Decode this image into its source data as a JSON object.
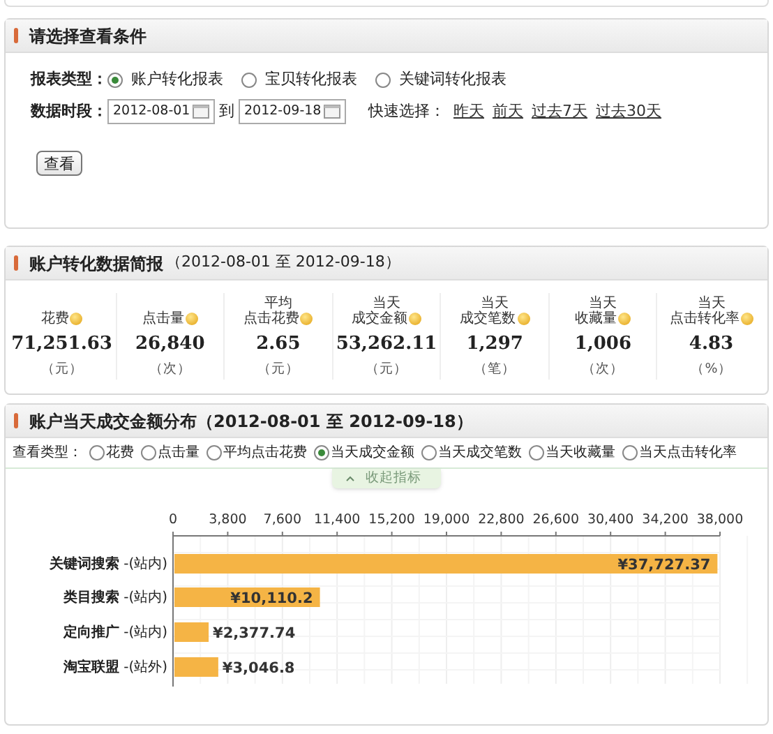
{
  "conditions_panel": {
    "title": "请选择查看条件",
    "report_type": {
      "label": "报表类型：",
      "options": [
        {
          "label": "账户转化报表",
          "selected": true
        },
        {
          "label": "宝贝转化报表",
          "selected": false
        },
        {
          "label": "关键词转化报表",
          "selected": false
        }
      ]
    },
    "date_range": {
      "label": "数据时段：",
      "start": "2012-08-01",
      "separator": "到",
      "end": "2012-09-18"
    },
    "quick_select": {
      "label": "快速选择：",
      "links": [
        "昨天",
        "前天",
        "过去7天",
        "过去30天"
      ]
    },
    "submit_button": "查看"
  },
  "summary_panel": {
    "title": "账户转化数据简报",
    "date_range": "（2012-08-01 至  2012-09-18）",
    "metrics": [
      {
        "label_lines": [
          "花费"
        ],
        "value": "71,251.63",
        "unit": "（元）"
      },
      {
        "label_lines": [
          "点击量"
        ],
        "value": "26,840",
        "unit": "（次）"
      },
      {
        "label_lines": [
          "平均",
          "点击花费"
        ],
        "value": "2.65",
        "unit": "（元）"
      },
      {
        "label_lines": [
          "当天",
          "成交金额"
        ],
        "value": "53,262.11",
        "unit": "（元）"
      },
      {
        "label_lines": [
          "当天",
          "成交笔数"
        ],
        "value": "1,297",
        "unit": "（笔）"
      },
      {
        "label_lines": [
          "当天",
          "收藏量"
        ],
        "value": "1,006",
        "unit": "（次）"
      },
      {
        "label_lines": [
          "当天",
          "点击转化率"
        ],
        "value": "4.83",
        "unit": "（%）"
      }
    ]
  },
  "distribution_panel": {
    "title": "账户当天成交金额分布（2012-08-01 至  2012-09-18）",
    "view_type": {
      "label": "查看类型：",
      "options": [
        {
          "label": "花费",
          "selected": false
        },
        {
          "label": "点击量",
          "selected": false
        },
        {
          "label": "平均点击花费",
          "selected": false
        },
        {
          "label": "当天成交金额",
          "selected": true
        },
        {
          "label": "当天成交笔数",
          "selected": false
        },
        {
          "label": "当天收藏量",
          "selected": false
        },
        {
          "label": "当天点击转化率",
          "selected": false
        }
      ]
    },
    "collapse_toggle": "收起指标",
    "chart_data": {
      "type": "bar",
      "orientation": "horizontal",
      "categories": [
        "**关键词搜索** -(站内)",
        "**类目搜索** -(站内)",
        "**定向推广** -(站内)",
        "**淘宝联盟** -(站外)"
      ],
      "series": [
        {
          "color": "#f5b445",
          "values": [
            37727.37,
            10110.2,
            2377.74,
            3046.8
          ]
        }
      ],
      "grid": true,
      "xlim": [
        0,
        38000
      ],
      "xticks": [
        {
          "value": 0,
          "label": "0"
        },
        {
          "value": 3800,
          "label": "3,800"
        },
        {
          "value": 7600,
          "label": "7,600"
        },
        {
          "value": 11400,
          "label": "11,400"
        },
        {
          "value": 15200,
          "label": "15,200"
        },
        {
          "value": 19000,
          "label": "19,000"
        },
        {
          "value": 22800,
          "label": "22,800"
        },
        {
          "value": 26600,
          "label": "26,600"
        },
        {
          "value": 30400,
          "label": "30,400"
        },
        {
          "value": 34200,
          "label": "34,200"
        },
        {
          "value": 38000,
          "label": "38,000"
        }
      ],
      "value_labels": [
        "¥37,727.37",
        "¥10,110.2",
        "¥2,377.74",
        "¥3,046.8"
      ]
    }
  }
}
